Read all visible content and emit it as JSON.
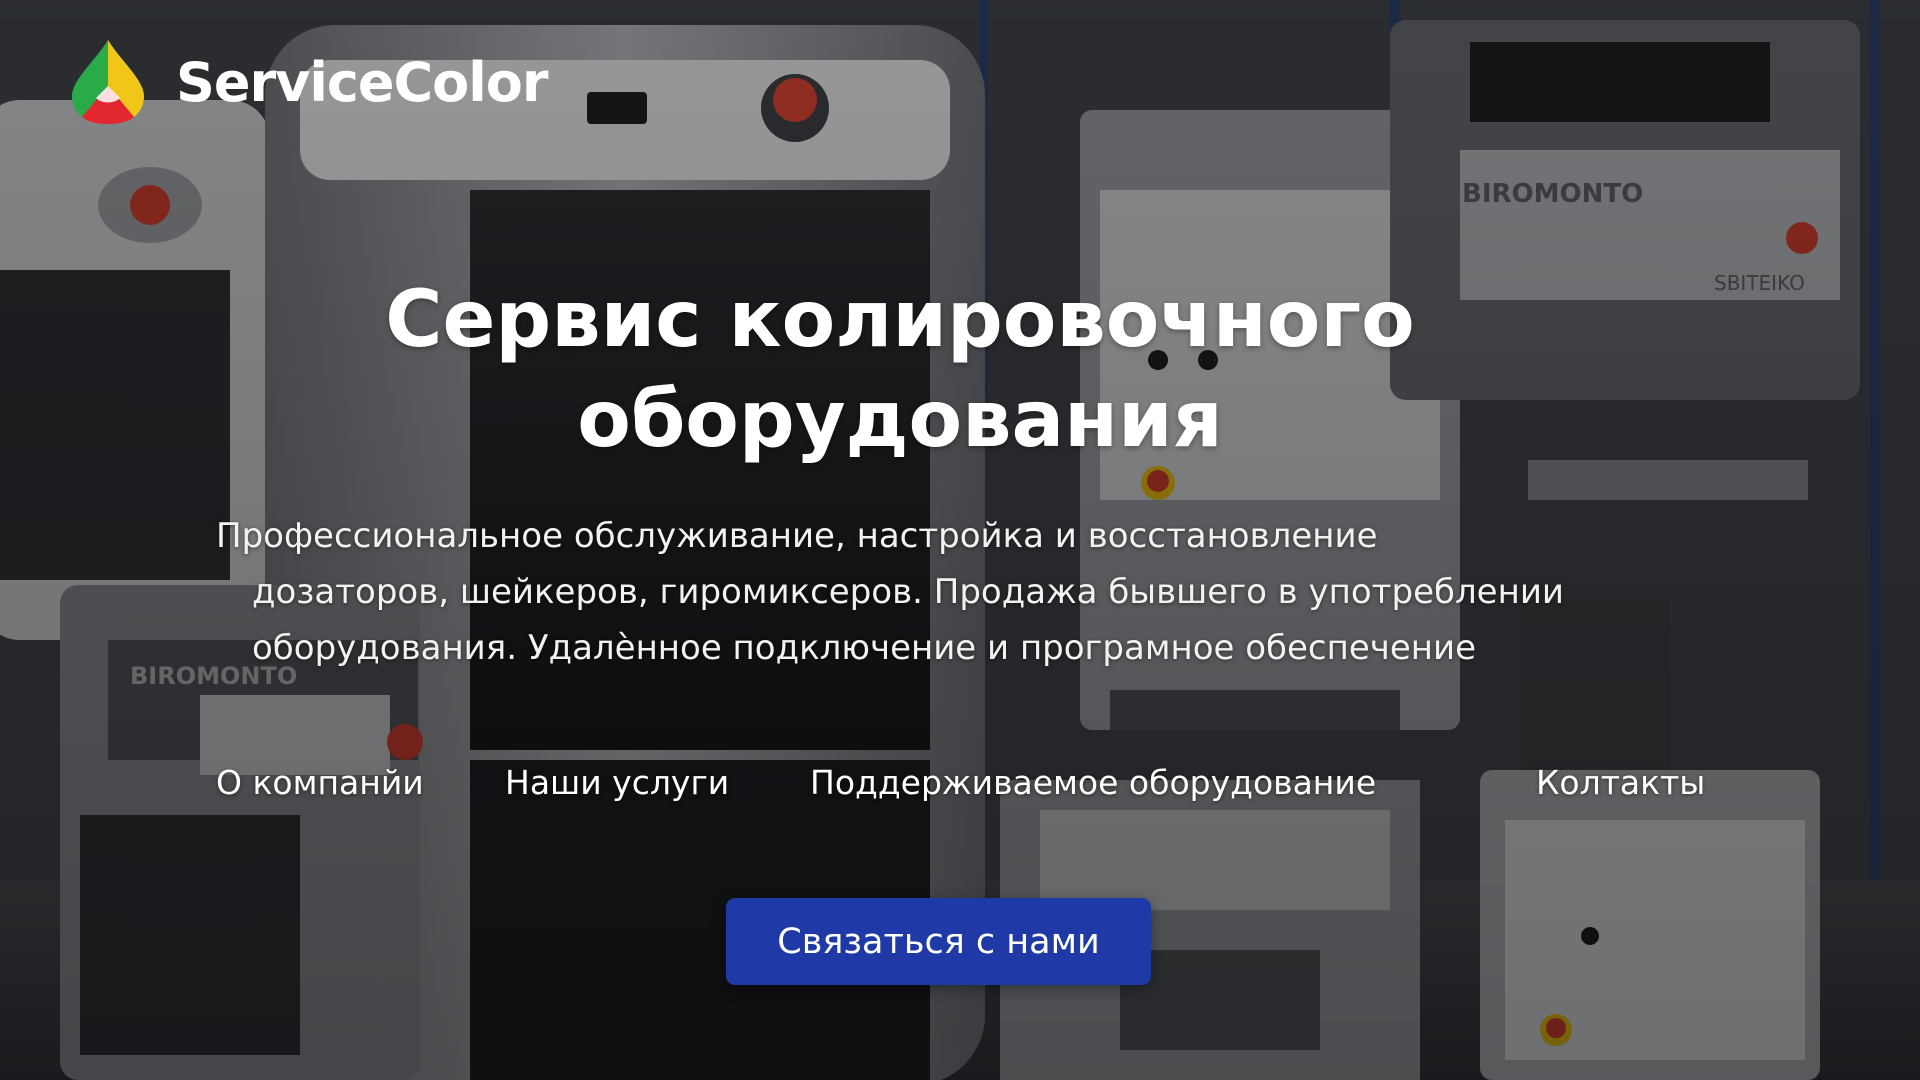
{
  "brand": {
    "name": "ServiceColor",
    "logo_icon": "paint-drop-logo",
    "logo_colors": [
      "#f2c618",
      "#e2272e",
      "#2bab47",
      "#1e88d8"
    ]
  },
  "hero": {
    "headline": {
      "line1": "Сервис колировочного",
      "line2": "оборудования"
    },
    "description": {
      "line1": "Профессиональное обслуживание, настройка и восстановление",
      "line2": "дозаторов, шейкеров, гиромиксеров. Продажа бывшего в употреблении",
      "line3": "оборудования. Удалѐнное подключение и програмное обеспечение"
    }
  },
  "nav": {
    "items": [
      {
        "label": "О компанйи"
      },
      {
        "label": "Наши услуги"
      },
      {
        "label": "Поддерживаемое оборудование"
      },
      {
        "label": "Колтакты"
      }
    ]
  },
  "cta": {
    "label": "Связаться с нами",
    "color": "#1f3aa6"
  },
  "background": {
    "subject": "tinting-equipment-photo",
    "machine_labels": [
      "BIROMONTO",
      "BIROMONTO",
      "SBITEIKO"
    ]
  }
}
